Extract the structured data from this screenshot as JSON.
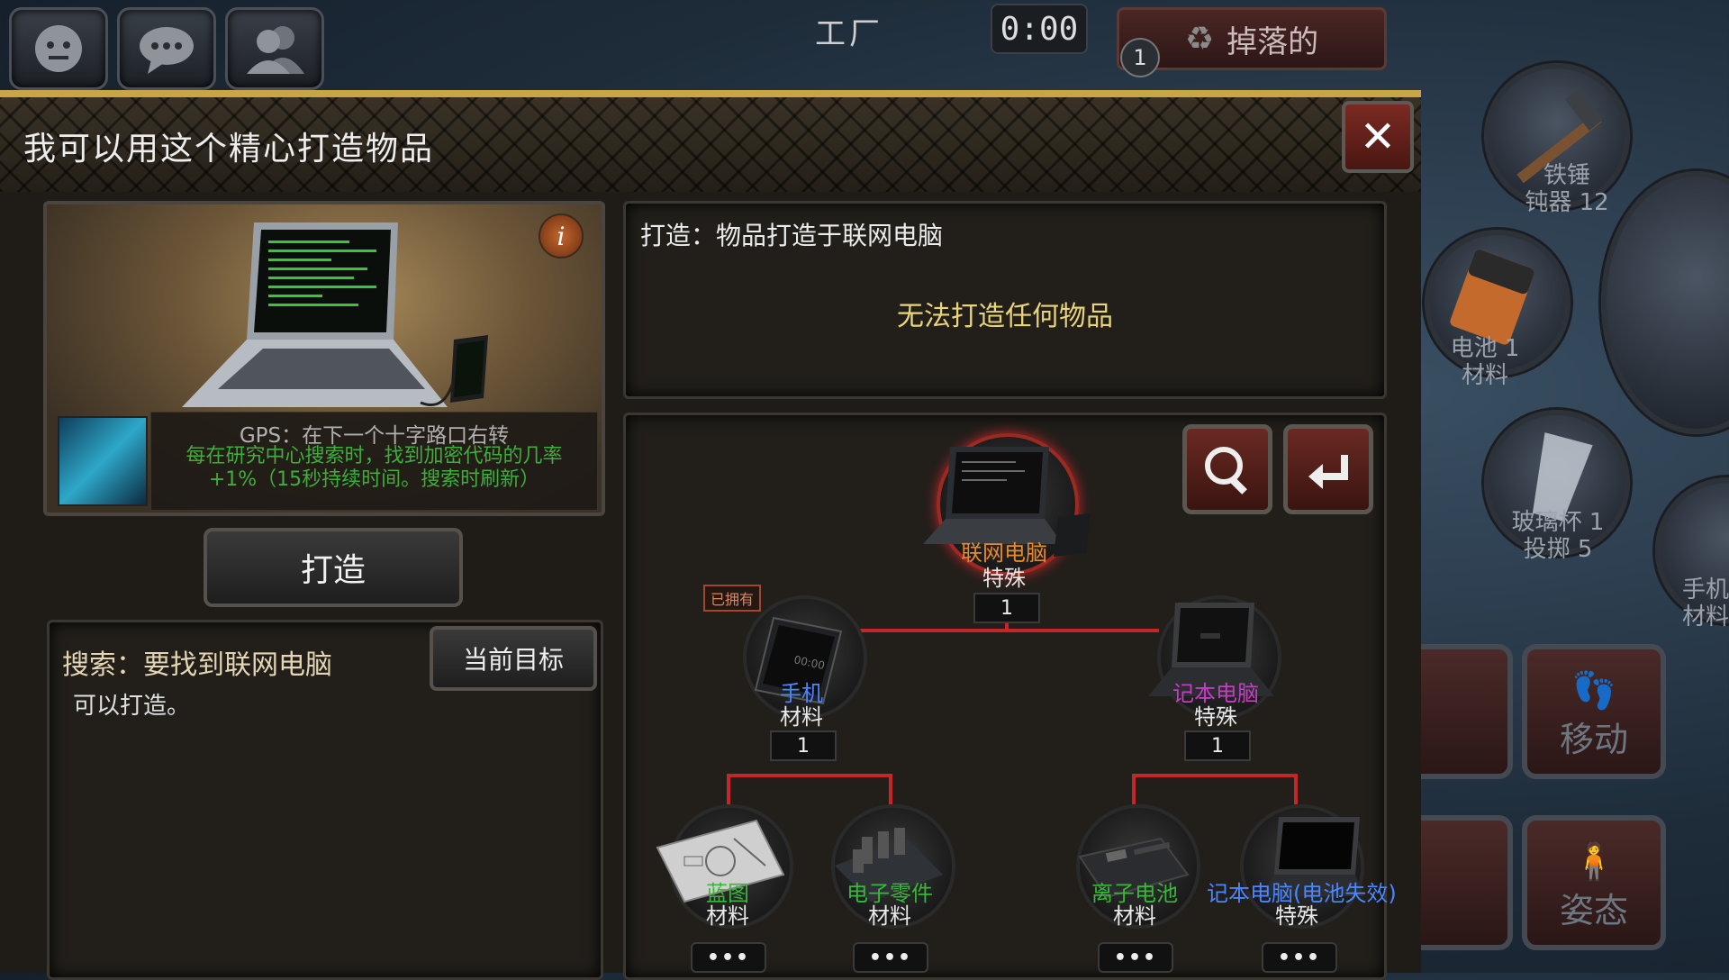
{
  "hud": {
    "location_title": "工厂",
    "timer": "0:00",
    "drop_label": "掉落的",
    "drop_count": "1"
  },
  "inventory_side": {
    "items": [
      {
        "name": "铁锤",
        "detail": "钝器 12"
      },
      {
        "name": "电池 1",
        "detail": "材料"
      },
      {
        "name": "玻璃杯 1",
        "detail": "投掷 5"
      },
      {
        "name": "手机",
        "detail": "材料"
      }
    ],
    "actions": [
      {
        "label": "移动",
        "icon": "footprint-icon"
      },
      {
        "label": "姿态",
        "icon": "stance-icon"
      }
    ]
  },
  "dialog": {
    "title": "我可以用这个精心打造物品",
    "close_label": "✕",
    "preview": {
      "item_name": "GPS：在下一个十字路口右转",
      "description": "每在研究中心搜索时，找到加密代码的几率+1%（15秒持续时间。搜索时刷新）"
    },
    "craft_button": "打造",
    "craft_info": {
      "title": "打造：物品打造于联网电脑",
      "message": "无法打造任何物品"
    },
    "search": {
      "title": "搜索：要找到联网电脑",
      "subtitle": "可以打造。",
      "target_button": "当前目标"
    },
    "tree": {
      "owned_tag": "已拥有",
      "root": {
        "name": "联网电脑",
        "type": "特殊",
        "qty": "1",
        "color": "#e8892c"
      },
      "level1": [
        {
          "name": "手机",
          "type": "材料",
          "qty": "1",
          "color": "#4a86ff"
        },
        {
          "name": "记本电脑",
          "type": "特殊",
          "qty": "1",
          "color": "#c23ec2"
        }
      ],
      "level2": [
        {
          "name": "蓝图",
          "type": "材料",
          "more": "•••",
          "color": "#39b73a"
        },
        {
          "name": "电子零件",
          "type": "材料",
          "more": "•••",
          "color": "#39b73a"
        },
        {
          "name": "离子电池",
          "type": "材料",
          "more": "•••",
          "color": "#39b73a"
        },
        {
          "name": "记本电脑(电池失效)",
          "type": "特殊",
          "more": "•••",
          "color": "#4a86ff"
        }
      ]
    }
  },
  "colors": {
    "accent_gold": "#c7a646",
    "tree_line": "#c4262a",
    "success_text": "#3fae3a",
    "warning_text": "#e9d47a"
  }
}
